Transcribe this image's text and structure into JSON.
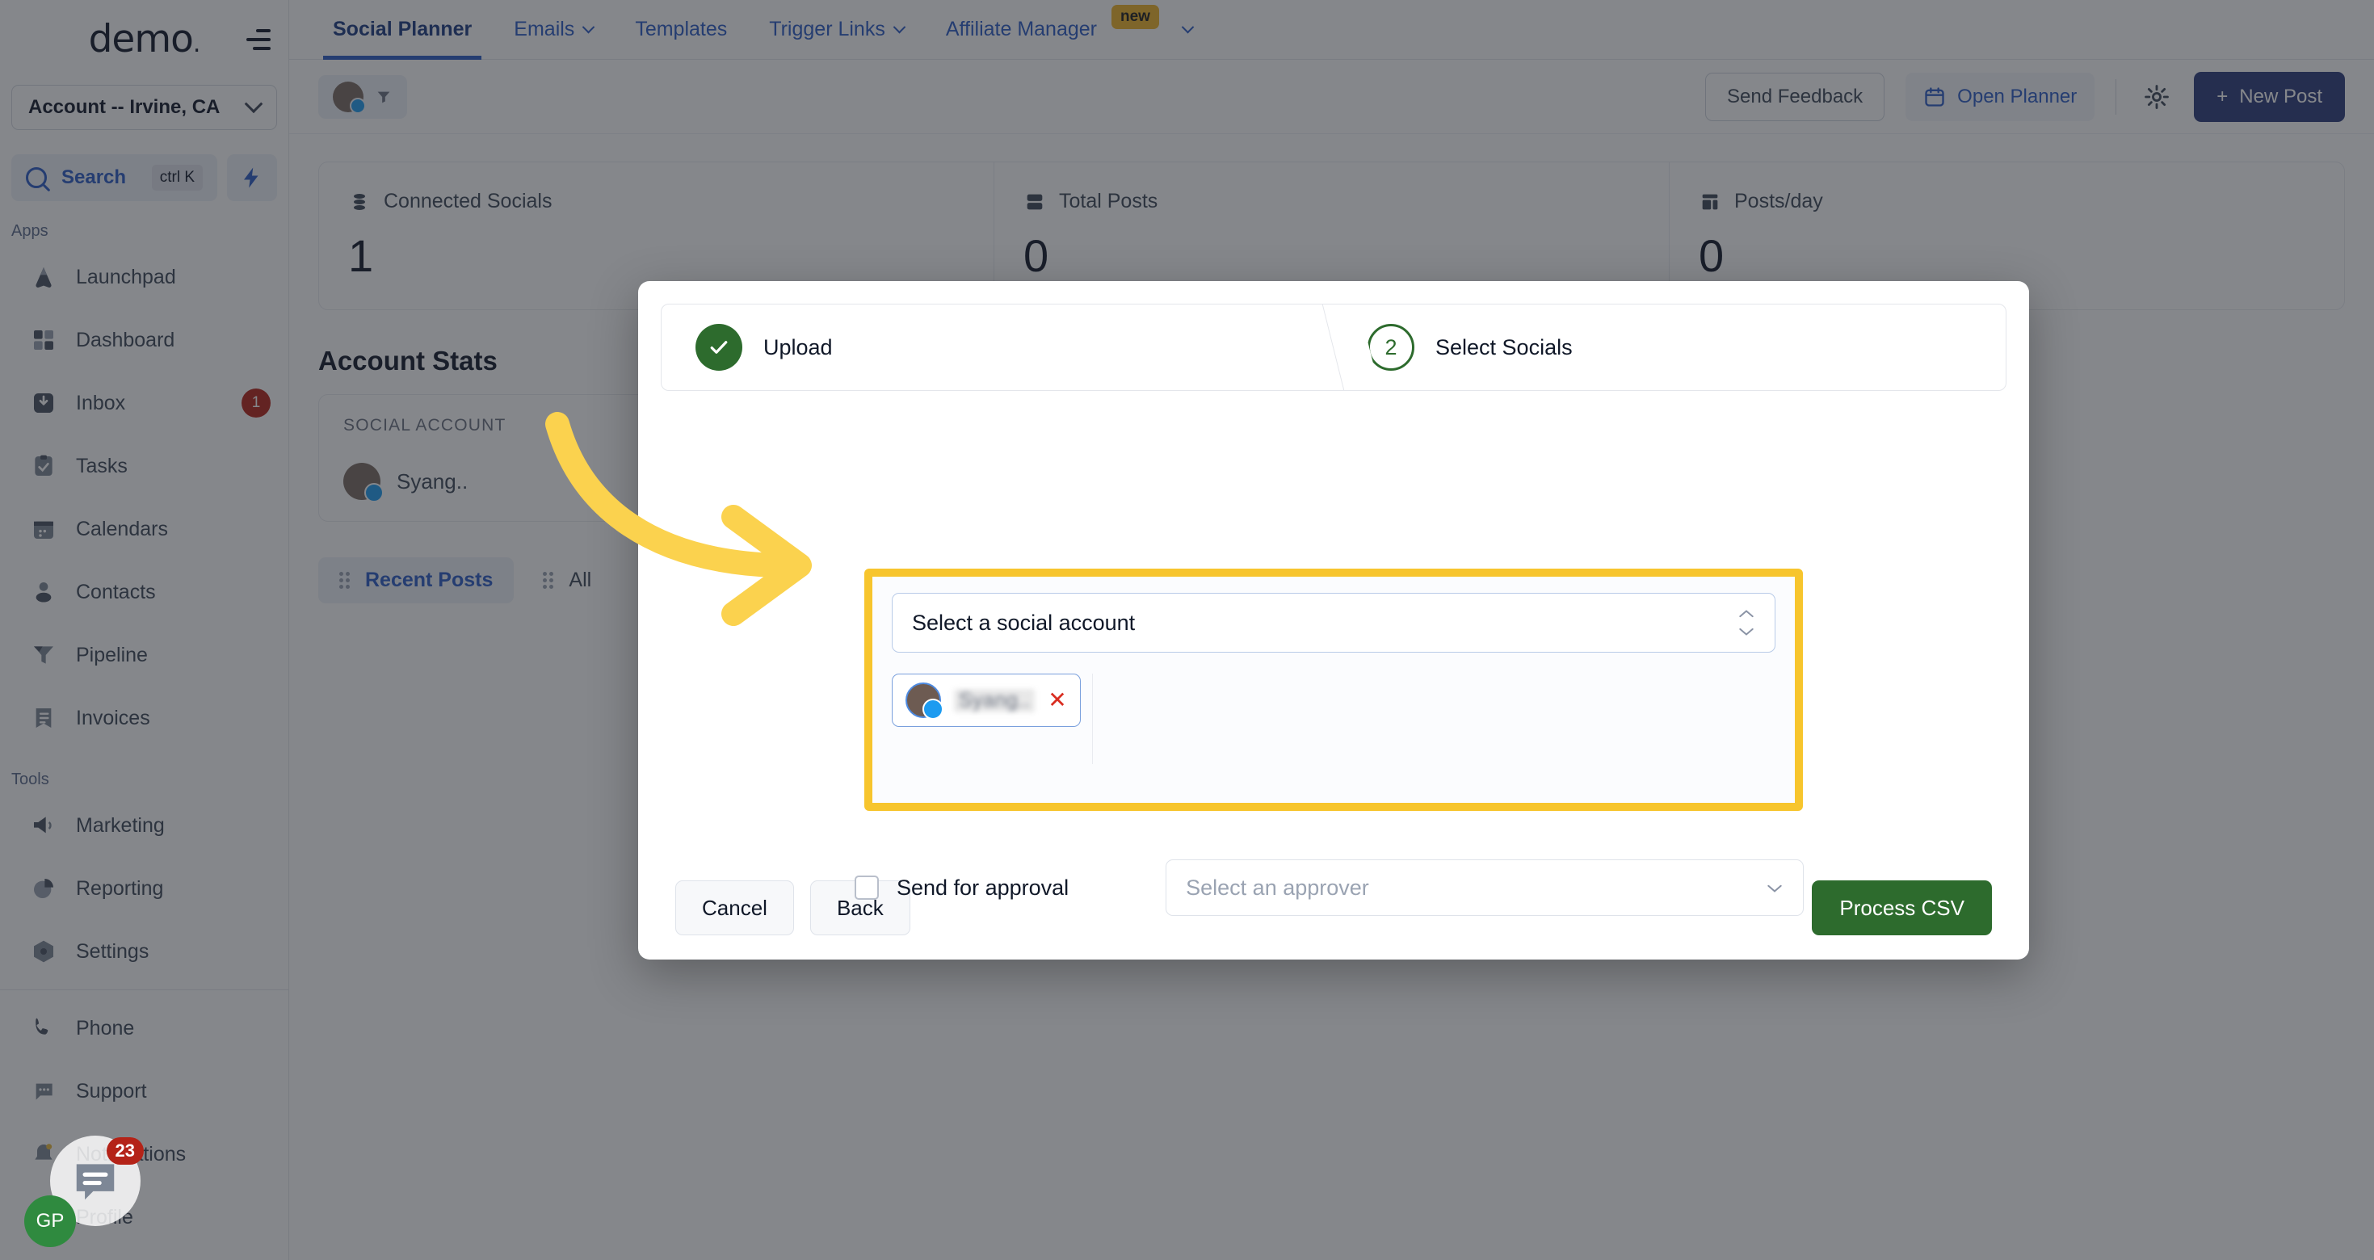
{
  "sidebar": {
    "logo": "demo",
    "logo_dot": ".",
    "account_selector": {
      "label": "Account -- Irvine, CA"
    },
    "search": {
      "label": "Search",
      "shortcut": "ctrl K"
    },
    "sections": [
      {
        "title": "Apps",
        "items": [
          {
            "label": "Launchpad",
            "icon": "launchpad-icon",
            "badge": ""
          },
          {
            "label": "Dashboard",
            "icon": "dashboard-icon",
            "badge": ""
          },
          {
            "label": "Inbox",
            "icon": "inbox-icon",
            "badge": "1"
          },
          {
            "label": "Tasks",
            "icon": "tasks-icon",
            "badge": ""
          },
          {
            "label": "Calendars",
            "icon": "calendar-icon",
            "badge": ""
          },
          {
            "label": "Contacts",
            "icon": "contacts-icon",
            "badge": ""
          },
          {
            "label": "Pipeline",
            "icon": "pipeline-icon",
            "badge": ""
          },
          {
            "label": "Invoices",
            "icon": "invoices-icon",
            "badge": ""
          }
        ]
      },
      {
        "title": "Tools",
        "items": [
          {
            "label": "Marketing",
            "icon": "megaphone-icon",
            "badge": ""
          },
          {
            "label": "Reporting",
            "icon": "piechart-icon",
            "badge": ""
          },
          {
            "label": "Settings",
            "icon": "gear-icon",
            "badge": ""
          }
        ]
      }
    ],
    "bottom_items": [
      {
        "label": "Phone",
        "icon": "phone-icon",
        "badge": ""
      },
      {
        "label": "Support",
        "icon": "chat-icon",
        "badge": ""
      },
      {
        "label": "Notifications",
        "icon": "bell-icon",
        "badge": ""
      },
      {
        "label": "Profile",
        "icon": "avatar-icon",
        "badge": ""
      }
    ],
    "chat_widget": {
      "badge": "23",
      "avatar_initials": "GP"
    }
  },
  "topnav": {
    "tabs": [
      {
        "label": "Social Planner",
        "has_caret": false,
        "active": true,
        "badge": ""
      },
      {
        "label": "Emails",
        "has_caret": true,
        "active": false,
        "badge": ""
      },
      {
        "label": "Templates",
        "has_caret": false,
        "active": false,
        "badge": ""
      },
      {
        "label": "Trigger Links",
        "has_caret": true,
        "active": false,
        "badge": ""
      },
      {
        "label": "Affiliate Manager",
        "has_caret": true,
        "active": false,
        "badge": "new"
      }
    ]
  },
  "toolbar": {
    "send_feedback": "Send Feedback",
    "open_planner": "Open Planner",
    "new_post": "New Post",
    "new_post_plus": "+"
  },
  "stats": [
    {
      "label": "Connected Socials",
      "value": "1",
      "icon": "stack-icon"
    },
    {
      "label": "Total Posts",
      "value": "0",
      "icon": "server-icon"
    },
    {
      "label": "Posts/day",
      "value": "0",
      "icon": "layout-icon"
    }
  ],
  "account_stats": {
    "title": "Account Stats",
    "column_header": "SOCIAL ACCOUNT",
    "rows": [
      {
        "name": "Syang..",
        "network": "twitter"
      }
    ],
    "tabs": [
      {
        "label": "Recent Posts",
        "selected": true
      },
      {
        "label": "All",
        "selected": false
      }
    ]
  },
  "modal": {
    "steps": [
      {
        "label": "Upload",
        "state": "done",
        "marker": "✓"
      },
      {
        "label": "Select Socials",
        "state": "active",
        "marker": "2"
      }
    ],
    "social_select": {
      "placeholder": "Select a social account"
    },
    "selected_chip": {
      "name": "Syang..",
      "network": "twitter",
      "remove": "✕"
    },
    "approval": {
      "checkbox_label": "Send for approval",
      "approver_placeholder": "Select an approver",
      "checked": false
    },
    "footer": {
      "cancel": "Cancel",
      "back": "Back",
      "submit": "Process CSV"
    }
  },
  "colors": {
    "accent_blue": "#2c5cc5",
    "primary_navy": "#2b3a7a",
    "green": "#2d6b2d",
    "highlight_yellow": "#f7c52d",
    "danger_red": "#b42318",
    "new_badge": "#f0b429"
  }
}
